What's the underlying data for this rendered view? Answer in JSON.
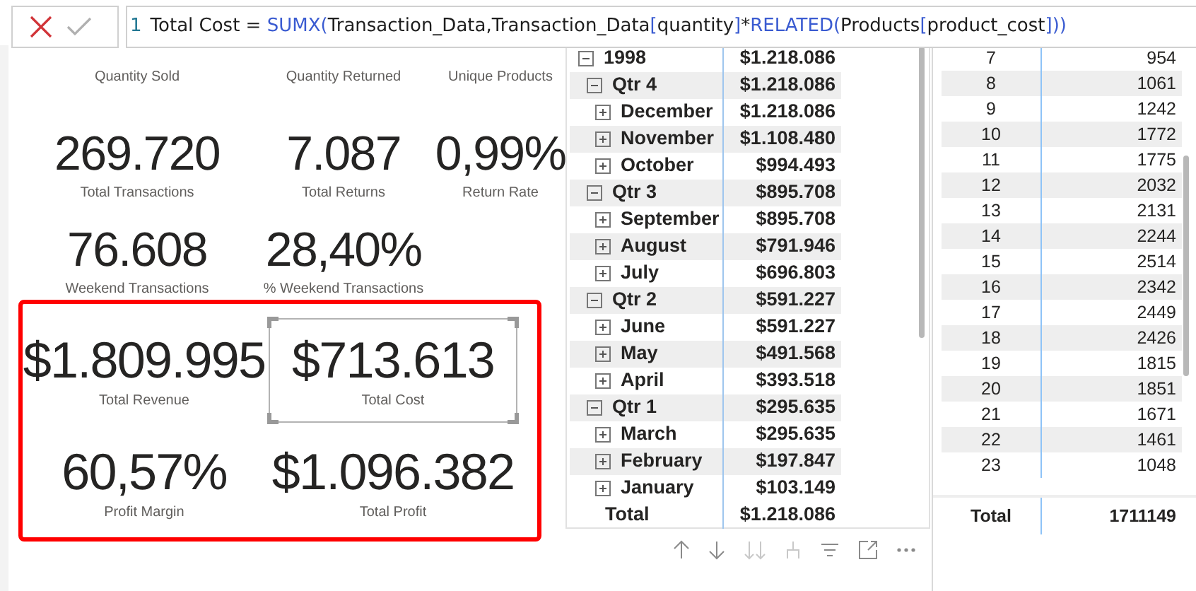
{
  "formula_bar": {
    "line_number": "1",
    "formula_parts": [
      {
        "kind": "plain",
        "text": "Total Cost = "
      },
      {
        "kind": "function",
        "text": "SUMX("
      },
      {
        "kind": "plain",
        "text": "Transaction_Data,Transaction_Data"
      },
      {
        "kind": "function",
        "text": "["
      },
      {
        "kind": "plain",
        "text": "quantity"
      },
      {
        "kind": "function",
        "text": "]"
      },
      {
        "kind": "plain",
        "text": "*"
      },
      {
        "kind": "function",
        "text": "RELATED("
      },
      {
        "kind": "plain",
        "text": "Products"
      },
      {
        "kind": "function",
        "text": "["
      },
      {
        "kind": "plain",
        "text": "product_cost"
      },
      {
        "kind": "function",
        "text": "]))"
      }
    ]
  },
  "kpi_rows": [
    {
      "cards": [
        {
          "label": "Quantity Sold"
        },
        {
          "label": "Quantity Returned"
        },
        {
          "label": "Unique Products"
        }
      ]
    },
    {
      "cards": [
        {
          "value": "269.720",
          "label": "Total Transactions"
        },
        {
          "value": "7.087",
          "label": "Total Returns"
        },
        {
          "value": "0,99%",
          "label": "Return Rate"
        }
      ]
    },
    {
      "cards": [
        {
          "value": "76.608",
          "label": "Weekend Transactions"
        },
        {
          "value": "28,40%",
          "label": "% Weekend Transactions"
        }
      ]
    }
  ],
  "highlighted_cards": [
    {
      "value": "$1.809.995",
      "label": "Total Revenue",
      "selected": false
    },
    {
      "value": "$713.613",
      "label": "Total Cost",
      "selected": true
    },
    {
      "value": "60,57%",
      "label": "Profit Margin",
      "selected": false
    },
    {
      "value": "$1.096.382",
      "label": "Total Profit",
      "selected": false
    }
  ],
  "matrix": {
    "rows": [
      {
        "label": "1998",
        "value": "$1.218.086",
        "expanded": true,
        "children": [
          {
            "label": "Qtr 4",
            "value": "$1.218.086",
            "expanded": true,
            "children": [
              {
                "label": "December",
                "value": "$1.218.086",
                "expanded": false
              },
              {
                "label": "November",
                "value": "$1.108.480",
                "expanded": false
              },
              {
                "label": "October",
                "value": "$994.493",
                "expanded": false
              }
            ]
          },
          {
            "label": "Qtr 3",
            "value": "$895.708",
            "expanded": true,
            "children": [
              {
                "label": "September",
                "value": "$895.708",
                "expanded": false
              },
              {
                "label": "August",
                "value": "$791.946",
                "expanded": false
              },
              {
                "label": "July",
                "value": "$696.803",
                "expanded": false
              }
            ]
          },
          {
            "label": "Qtr 2",
            "value": "$591.227",
            "expanded": true,
            "children": [
              {
                "label": "June",
                "value": "$591.227",
                "expanded": false
              },
              {
                "label": "May",
                "value": "$491.568",
                "expanded": false
              },
              {
                "label": "April",
                "value": "$393.518",
                "expanded": false
              }
            ]
          },
          {
            "label": "Qtr 1",
            "value": "$295.635",
            "expanded": true,
            "children": [
              {
                "label": "March",
                "value": "$295.635",
                "expanded": false
              },
              {
                "label": "February",
                "value": "$197.847",
                "expanded": false
              },
              {
                "label": "January",
                "value": "$103.149",
                "expanded": false
              }
            ]
          }
        ]
      }
    ],
    "total_label": "Total",
    "total_value": "$1.218.086"
  },
  "table": {
    "rows": [
      [
        "7",
        "954"
      ],
      [
        "8",
        "1061"
      ],
      [
        "9",
        "1242"
      ],
      [
        "10",
        "1772"
      ],
      [
        "11",
        "1775"
      ],
      [
        "12",
        "2032"
      ],
      [
        "13",
        "2131"
      ],
      [
        "14",
        "2244"
      ],
      [
        "15",
        "2514"
      ],
      [
        "16",
        "2342"
      ],
      [
        "17",
        "2449"
      ],
      [
        "18",
        "2426"
      ],
      [
        "19",
        "1815"
      ],
      [
        "20",
        "1851"
      ],
      [
        "21",
        "1671"
      ],
      [
        "22",
        "1461"
      ],
      [
        "23",
        "1048"
      ]
    ],
    "total_label": "Total",
    "total_value": "1711149"
  }
}
